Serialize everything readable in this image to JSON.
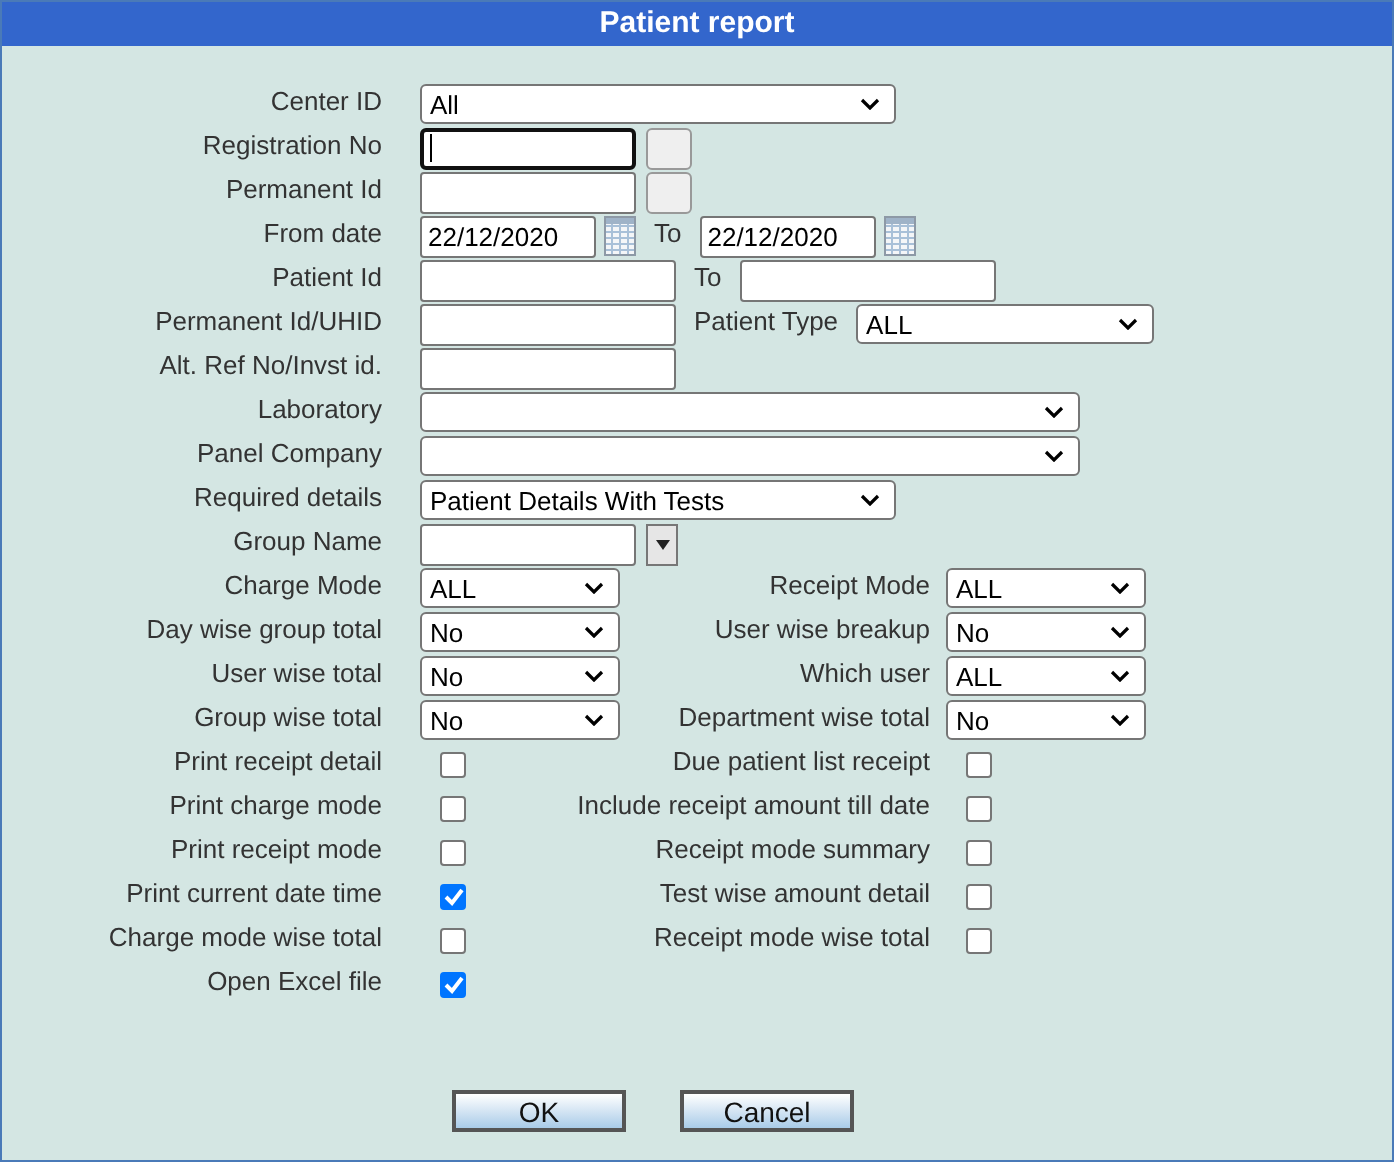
{
  "window": {
    "title": "Patient report"
  },
  "rows": [
    {
      "kind": "single",
      "label": "Center ID",
      "controls": [
        {
          "kind": "select-medium",
          "value": "All"
        }
      ]
    },
    {
      "kind": "single",
      "label": "Registration No",
      "controls": [
        {
          "kind": "text-short",
          "focused": true
        },
        {
          "kind": "lookup"
        }
      ]
    },
    {
      "kind": "single",
      "label": "Permanent Id",
      "controls": [
        {
          "kind": "text-short",
          "focused": false
        },
        {
          "kind": "lookup"
        }
      ]
    },
    {
      "kind": "single",
      "label": "From date",
      "controls": [
        {
          "kind": "text-date",
          "value": "22/12/2020",
          "focused": false
        },
        {
          "kind": "calendar"
        },
        {
          "kind": "caption",
          "text": "To"
        },
        {
          "kind": "text-date",
          "value": "22/12/2020",
          "focused": false
        },
        {
          "kind": "calendar"
        }
      ]
    },
    {
      "kind": "single",
      "label": "Patient Id",
      "controls": [
        {
          "kind": "text-medium",
          "focused": false
        },
        {
          "kind": "caption",
          "text": "To"
        },
        {
          "kind": "text-medium",
          "focused": false
        }
      ]
    },
    {
      "kind": "single",
      "label": "Permanent Id/UHID",
      "controls": [
        {
          "kind": "text-medium",
          "focused": false
        },
        {
          "kind": "caption",
          "text": "Patient Type"
        },
        {
          "kind": "select-type",
          "value": "ALL"
        }
      ]
    },
    {
      "kind": "single",
      "label": "Alt. Ref No/Invst id.",
      "controls": [
        {
          "kind": "text-medium",
          "focused": false
        }
      ]
    },
    {
      "kind": "single",
      "label": "Laboratory",
      "controls": [
        {
          "kind": "select-long"
        }
      ]
    },
    {
      "kind": "single",
      "label": "Panel Company",
      "controls": [
        {
          "kind": "select-long"
        }
      ]
    },
    {
      "kind": "single",
      "label": "Required details",
      "controls": [
        {
          "kind": "select-medium",
          "value": "Patient Details With Tests"
        }
      ]
    },
    {
      "kind": "single",
      "label": "Group Name",
      "controls": [
        {
          "kind": "text-short",
          "focused": false
        },
        {
          "kind": "combo"
        }
      ]
    },
    {
      "kind": "two-column",
      "label": "Charge Mode",
      "controls": [
        {
          "kind": "select",
          "value": "ALL"
        }
      ],
      "label_2": "Receipt Mode",
      "controls_2": [
        {
          "kind": "select",
          "value": "ALL"
        }
      ]
    },
    {
      "kind": "two-column",
      "label": "Day wise group total",
      "controls": [
        {
          "kind": "select",
          "value": "No"
        }
      ],
      "label_2": "User wise breakup",
      "controls_2": [
        {
          "kind": "select",
          "value": "No"
        }
      ]
    },
    {
      "kind": "two-column",
      "label": "User wise total",
      "controls": [
        {
          "kind": "select",
          "value": "No"
        }
      ],
      "label_2": "Which user",
      "controls_2": [
        {
          "kind": "select",
          "value": "ALL"
        }
      ]
    },
    {
      "kind": "two-column",
      "label": "Group wise total",
      "controls": [
        {
          "kind": "select",
          "value": "No"
        }
      ],
      "label_2": "Department wise total",
      "controls_2": [
        {
          "kind": "select",
          "value": "No"
        }
      ]
    },
    {
      "kind": "two-column",
      "label": "Print receipt detail",
      "controls": [
        {
          "kind": "checkbox",
          "checked": false
        }
      ],
      "label_2": "Due patient list receipt",
      "controls_2": [
        {
          "kind": "checkbox",
          "checked": false
        }
      ]
    },
    {
      "kind": "two-column",
      "label": "Print charge mode",
      "controls": [
        {
          "kind": "checkbox",
          "checked": false
        }
      ],
      "label_2": "Include receipt amount till date",
      "controls_2": [
        {
          "kind": "checkbox",
          "checked": false
        }
      ]
    },
    {
      "kind": "two-column",
      "label": "Print receipt mode",
      "controls": [
        {
          "kind": "checkbox",
          "checked": false
        }
      ],
      "label_2": "Receipt mode summary",
      "controls_2": [
        {
          "kind": "checkbox",
          "checked": false
        }
      ]
    },
    {
      "kind": "two-column",
      "label": "Print current date time",
      "controls": [
        {
          "kind": "checkbox",
          "checked": true
        }
      ],
      "label_2": "Test wise amount detail",
      "controls_2": [
        {
          "kind": "checkbox",
          "checked": false
        }
      ]
    },
    {
      "kind": "two-column",
      "label": "Charge mode wise total",
      "controls": [
        {
          "kind": "checkbox",
          "checked": false
        }
      ],
      "label_2": "Receipt mode wise total",
      "controls_2": [
        {
          "kind": "checkbox",
          "checked": false
        }
      ]
    },
    {
      "kind": "single",
      "label": "Open Excel file",
      "controls": [
        {
          "kind": "checkbox",
          "checked": true
        }
      ]
    }
  ],
  "buttons": [
    "OK",
    "Cancel"
  ]
}
